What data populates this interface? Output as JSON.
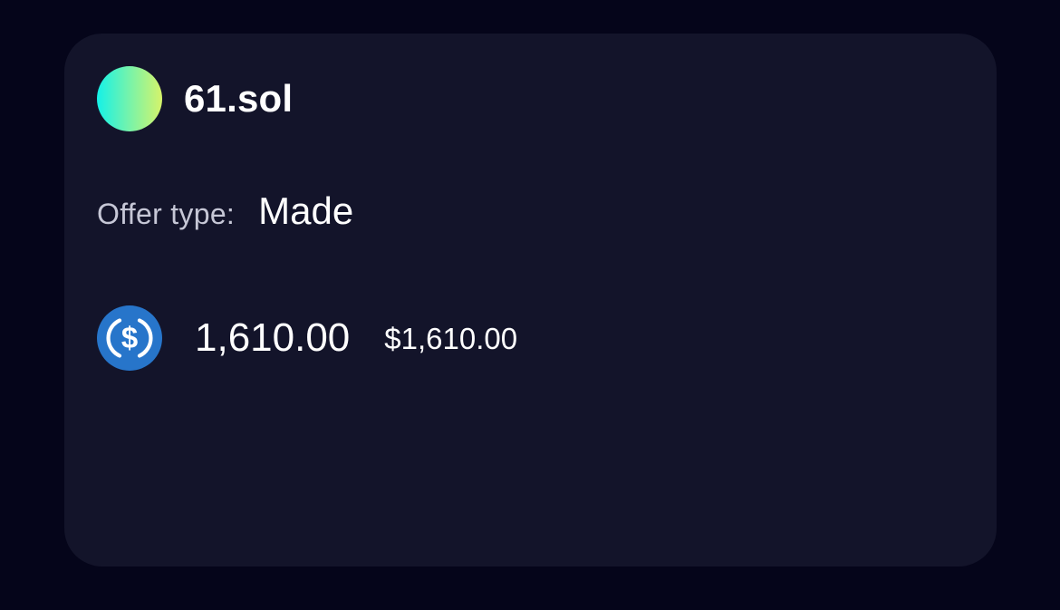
{
  "colors": {
    "page_background": "#05051a",
    "card_background": "#13142a",
    "usdc_blue": "#2775ca",
    "avatar_gradient": [
      "#14f1e8",
      "#d6f36a"
    ]
  },
  "listing": {
    "domain": "61.sol",
    "offer_type_label": "Offer type:",
    "offer_type_value": "Made",
    "price": {
      "token_icon": "usdc-icon",
      "amount": "1,610.00",
      "usd_value": "$1,610.00"
    }
  }
}
